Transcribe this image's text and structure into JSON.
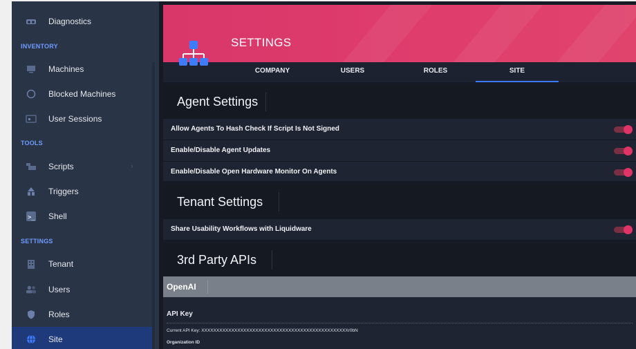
{
  "sidebar": {
    "items": [
      {
        "label": "Diagnostics",
        "icon": "diagnostics-icon"
      },
      {
        "label": "Machines",
        "icon": "monitor-icon"
      },
      {
        "label": "Blocked Machines",
        "icon": "blocked-icon"
      },
      {
        "label": "User Sessions",
        "icon": "user-session-icon"
      },
      {
        "label": "Scripts",
        "icon": "script-icon"
      },
      {
        "label": "Triggers",
        "icon": "trigger-icon"
      },
      {
        "label": "Shell",
        "icon": "terminal-icon"
      },
      {
        "label": "Tenant",
        "icon": "building-icon"
      },
      {
        "label": "Users",
        "icon": "users-icon"
      },
      {
        "label": "Roles",
        "icon": "shield-icon"
      },
      {
        "label": "Site",
        "icon": "globe-icon"
      }
    ],
    "sections": {
      "inventory": "INVENTORY",
      "tools": "TOOLS",
      "settings": "SETTINGS"
    },
    "active": "Site",
    "accent": "#6f9bff"
  },
  "header": {
    "title": "SETTINGS",
    "tabs": [
      {
        "label": "COMPANY"
      },
      {
        "label": "USERS"
      },
      {
        "label": "ROLES"
      },
      {
        "label": "SITE"
      }
    ],
    "active_tab": "SITE",
    "banner_color": "#dd3c6b",
    "tab_accent": "#3d7bff"
  },
  "agent_settings": {
    "title": "Agent Settings",
    "rows": [
      {
        "label": "Allow Agents To Hash Check If Script Is Not Signed",
        "enabled": true
      },
      {
        "label": "Enable/Disable Agent Updates",
        "enabled": true
      },
      {
        "label": "Enable/Disable Open Hardware Monitor On Agents",
        "enabled": true
      }
    ]
  },
  "tenant_settings": {
    "title": "Tenant Settings",
    "rows": [
      {
        "label": "Share Usability Workflows with Liquidware",
        "enabled": true
      }
    ]
  },
  "third_party": {
    "title": "3rd Party APIs",
    "openai": {
      "title": "OpenAI",
      "api_key_label": "API Key",
      "current_key": "Current API Key: XXXXXXXXXXXXXXXXXXXXXXXXXXXXXXXXXXXXXXXXXXXXXXXXXr0bN",
      "org_label": "Organization ID"
    }
  },
  "toggle_color": "#e03466"
}
